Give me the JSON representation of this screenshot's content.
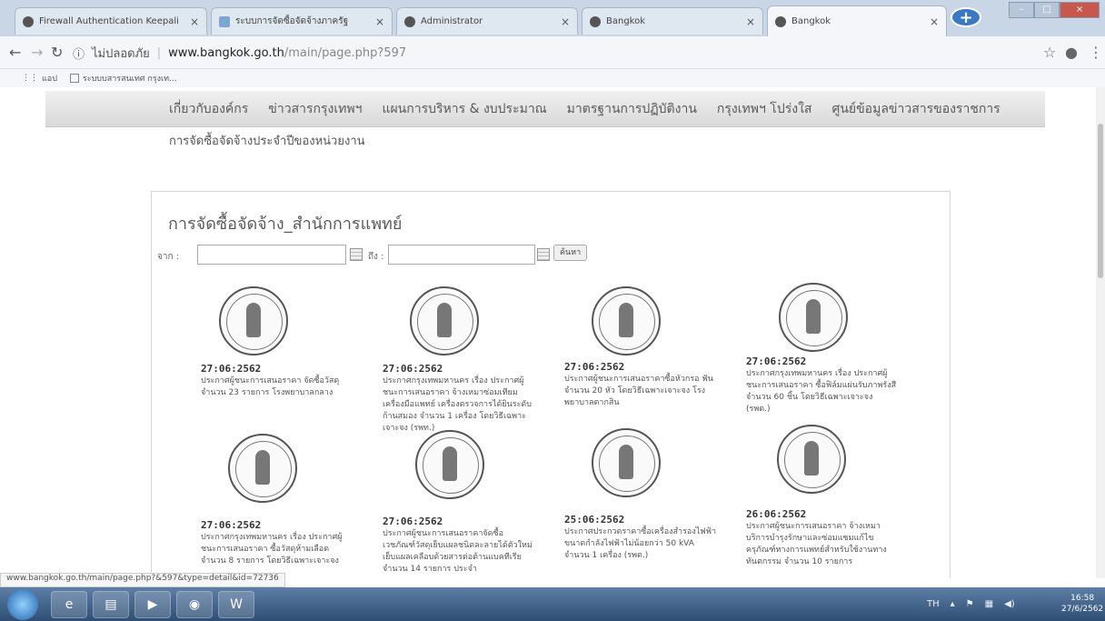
{
  "tabs": [
    {
      "label": "Firewall Authentication Keepali",
      "icon": "globe-icon"
    },
    {
      "label": "ระบบการจัดซื้อจัดจ้างภาครัฐ",
      "icon": "thai-site-icon"
    },
    {
      "label": "Administrator",
      "icon": "globe-icon"
    },
    {
      "label": "Bangkok",
      "icon": "globe-icon"
    },
    {
      "label": "Bangkok",
      "icon": "globe-icon"
    }
  ],
  "address": {
    "insecure_label": "ไม่ปลอดภัย",
    "host": "www.bangkok.go.th",
    "path": "/main/page.php?597"
  },
  "bookmarks": [
    {
      "label": "แอป"
    },
    {
      "label": "ระบบบสารสนเทศ กรุงเท..."
    }
  ],
  "site_nav": [
    "เกี่ยวกับองค์กร",
    "ข่าวสารกรุงเทพฯ",
    "แผนการบริหาร & งบประมาณ",
    "มาตรฐานการปฏิบัติงาน",
    "กรุงเทพฯ โปร่งใส",
    "ศูนย์ข้อมูลข่าวสารของราชการ"
  ],
  "breadcrumb": "การจัดซื้อจัดจ้างประจำปีของหน่วยงาน",
  "panel": {
    "title": "การจัดซื้อจัดจ้าง_สำนักการแพทย์",
    "from_label": "จาก :",
    "to_label": "ถึง :",
    "search_label": "ค้นหา"
  },
  "cards": [
    {
      "date": "27:06:2562",
      "text": "ประกาศผู้ชนะการเสนอราคา จัดซื้อวัสดุ จำนวน 23 รายการ โรงพยาบาลกลาง"
    },
    {
      "date": "27:06:2562",
      "text": "ประกาศกรุงเทพมหานคร เรื่อง ประกาศผู้ชนะการเสนอราคา จ้างเหมาซ่อมเทียมเครื่องมือแพทย์ เครื่องตรวจการได้ยินระดับก้านสมอง จำนวน 1 เครื่อง โดยวิธีเฉพาะเจาะจง (รพท.)"
    },
    {
      "date": "27:06:2562",
      "text": "ประกาศผู้ชนะการเสนอราคาซื้อหัวกรอ ฟันจำนวน 20 หัว โดยวิธีเฉพาะเจาะจง โรงพยาบาลตากสิน"
    },
    {
      "date": "27:06:2562",
      "text": "ประกาศกรุงเทพมหานคร เรื่อง ประกาศผู้ชนะการเสนอราคา ซื้อฟิล์มแผ่นรับภาพรังสี จำนวน 60 ชิ้น โดยวิธีเฉพาะเจาะจง (รพต.)"
    },
    {
      "date": "27:06:2562",
      "text": "ประกาศกรุงเทพมหานคร เรื่อง ประกาศผู้ชนะการเสนอราคา ซื้อวัสดุห้ามเลือด จำนวน 8 รายการ โดยวิธีเฉพาะเจาะจง"
    },
    {
      "date": "27:06:2562",
      "text": "ประกาศผู้ชนะการเสนอราคาจัดซื้อเวชภัณฑ์วัสดุเย็บแผลชนิดละลายได้ตัวใหม่เย็บแผลเคลือบด้วยสารต่อต้านแบคทีเรีย จำนวน 14 รายการ ประจำ"
    },
    {
      "date": "25:06:2562",
      "text": "ประกาศประกวดราคาซื้อเครื่องสำรองไฟฟ้าขนาดกำลังไฟฟ้าไม่น้อยกว่า 50 kVA จำนวน 1 เครื่อง (รพต.)"
    },
    {
      "date": "26:06:2562",
      "text": "ประกาศผู้ชนะการเสนอราคา จ้างเหมาบริการบำรุงรักษาและซ่อมแซมแก้ไขครุภัณฑ์ทางการแพทย์สำหรับใช้งานทางทันตกรรม จำนวน 10 รายการ"
    }
  ],
  "status_url": "www.bangkok.go.th/main/page.php?&597&type=detail&id=72736",
  "taskbar": {
    "lang": "TH",
    "time": "16:58",
    "date": "27/6/2562"
  }
}
